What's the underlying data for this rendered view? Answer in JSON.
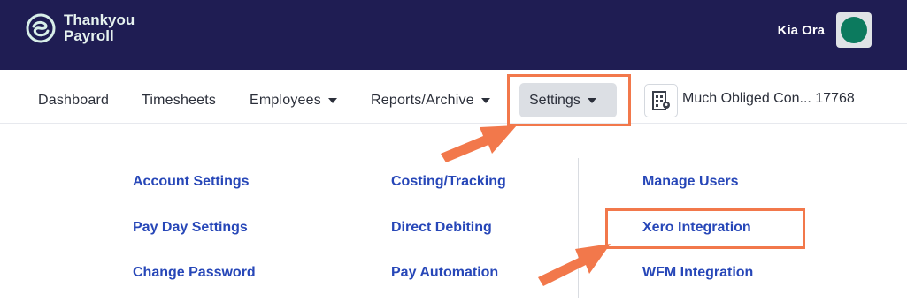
{
  "brand": {
    "line1": "Thankyou",
    "line2": "Payroll"
  },
  "user": {
    "greeting": "Kia Ora"
  },
  "nav": {
    "dashboard": "Dashboard",
    "timesheets": "Timesheets",
    "employees": "Employees",
    "reports": "Reports/Archive",
    "settings": "Settings",
    "company": "Much Obliged Con... 17768"
  },
  "menu": {
    "col1": [
      "Account Settings",
      "Pay Day Settings",
      "Change Password"
    ],
    "col2": [
      "Costing/Tracking",
      "Direct Debiting",
      "Pay Automation"
    ],
    "col3": [
      "Manage Users",
      "Xero Integration",
      "WFM Integration"
    ]
  },
  "colors": {
    "header_bg": "#1f1d53",
    "link": "#2747b8",
    "highlight": "#f2784b",
    "avatar": "#0c7a5e"
  },
  "icons": [
    "thankyou-logo-icon",
    "chevron-down-icon",
    "building-icon",
    "arrow-pointer-icon"
  ]
}
